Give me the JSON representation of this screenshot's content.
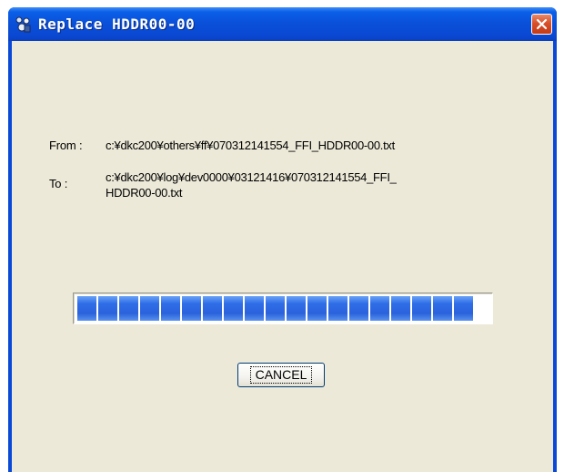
{
  "window": {
    "title": "Replace HDDR00-00"
  },
  "dialog": {
    "from_label": "From :",
    "from_path": "c:¥dkc200¥others¥ff¥070312141554_FFI_HDDR00-00.txt",
    "to_label": "To :",
    "to_path_line1": "c:¥dkc200¥log¥dev0000¥03121416¥070312141554_FFI_",
    "to_path_line2": "HDDR00-00.txt",
    "progress_percent": 100,
    "cancel_label": "CANCEL"
  },
  "icons": {
    "app": "app-icon",
    "close": "close-icon"
  },
  "colors": {
    "titlebar": "#0a49d8",
    "client_bg": "#ece9d8",
    "progress_fill": "#2f6ee8",
    "close_button": "#d8502a"
  }
}
